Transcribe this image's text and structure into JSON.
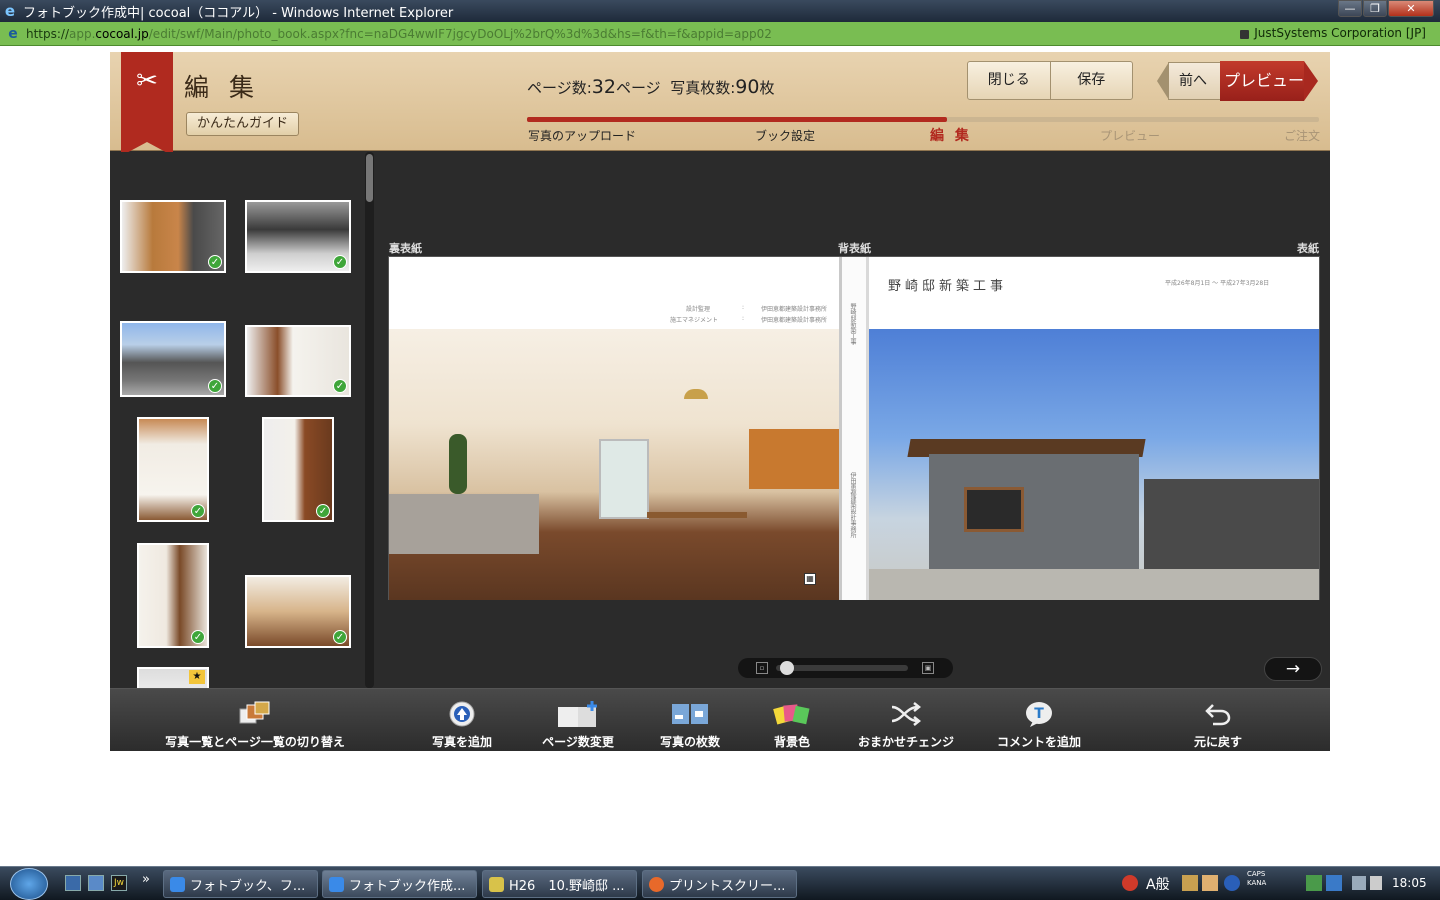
{
  "window": {
    "title": "フォトブック作成中| cocoal（ココアル） - Windows Internet Explorer",
    "min": "—",
    "max": "❐",
    "close": "✕"
  },
  "addressbar": {
    "url_scheme": "https://",
    "url_host_pre": "app.",
    "url_host": "cocoal.jp",
    "url_path": "/edit/swf/Main/photo_book.aspx?fnc=naDG4wwIF7jgcyDoOLj%2brQ%3d%3d&hs=f&th=f&appid=app02",
    "certificate": "JustSystems Corporation [JP]"
  },
  "header": {
    "title": "編 集",
    "guide_button": "かんたんガイド",
    "pages_label": "ページ数:",
    "pages_value": "32",
    "pages_unit": "ページ",
    "photos_label": "写真枚数:",
    "photos_value": "90",
    "photos_unit": "枚",
    "close_button": "閉じる",
    "save_button": "保存",
    "prev_button": "前へ",
    "preview_button": "プレビュー",
    "progress": 0.53,
    "steps": [
      "写真のアップロード",
      "ブック設定",
      "編 集",
      "プレビュー",
      "ご注文"
    ]
  },
  "spread": {
    "back_cover_label": "裏表紙",
    "spine_label": "背表紙",
    "cover_label": "表紙",
    "book_title": "野崎邸新築工事",
    "credit1_label": "設計監理",
    "credit1_value": "伊田恵都建築設計事務所",
    "credit2_label": "施工マネジメント",
    "credit2_value": "伊田恵都建築設計事務所",
    "colon": ":",
    "cover_date": "平成26年8月1日 ～ 平成27年3月28日",
    "spine_text1": "野崎邸新築工事",
    "spine_text2": "伊田恵都建築設計事務所"
  },
  "sidebar": {
    "thumbnails": [
      "✓",
      "✓",
      "✓",
      "✓",
      "✓",
      "✓",
      "✓",
      "✓",
      "★"
    ]
  },
  "zoom": {
    "min_icon": "▫",
    "max_icon": "▣",
    "level": 0.02
  },
  "next_page": "→",
  "toolbar": [
    {
      "label": "写真一覧とページ一覧の切り替え",
      "icon": "photo-list-toggle-icon"
    },
    {
      "label": "写真を追加",
      "icon": "add-photo-icon"
    },
    {
      "label": "ページ数変更",
      "icon": "page-count-icon"
    },
    {
      "label": "写真の枚数",
      "icon": "photo-count-icon"
    },
    {
      "label": "背景色",
      "icon": "background-color-icon"
    },
    {
      "label": "おまかせチェンジ",
      "icon": "shuffle-icon"
    },
    {
      "label": "コメントを追加",
      "icon": "comment-icon"
    },
    {
      "label": "元に戻す",
      "icon": "undo-icon"
    }
  ],
  "taskbar": {
    "more": "»",
    "buttons": [
      "フォトブック、フ...",
      "フォトブック作成...",
      "H26　10.野崎邸 ...",
      "プリントスクリー..."
    ],
    "ime": "A般",
    "caps": "CAPS",
    "kana": "KANA",
    "clock": "18:05"
  },
  "colors": {
    "accent_red": "#b02a1f",
    "header_bg": "#e0c79d",
    "addr_green": "#79bd52"
  }
}
